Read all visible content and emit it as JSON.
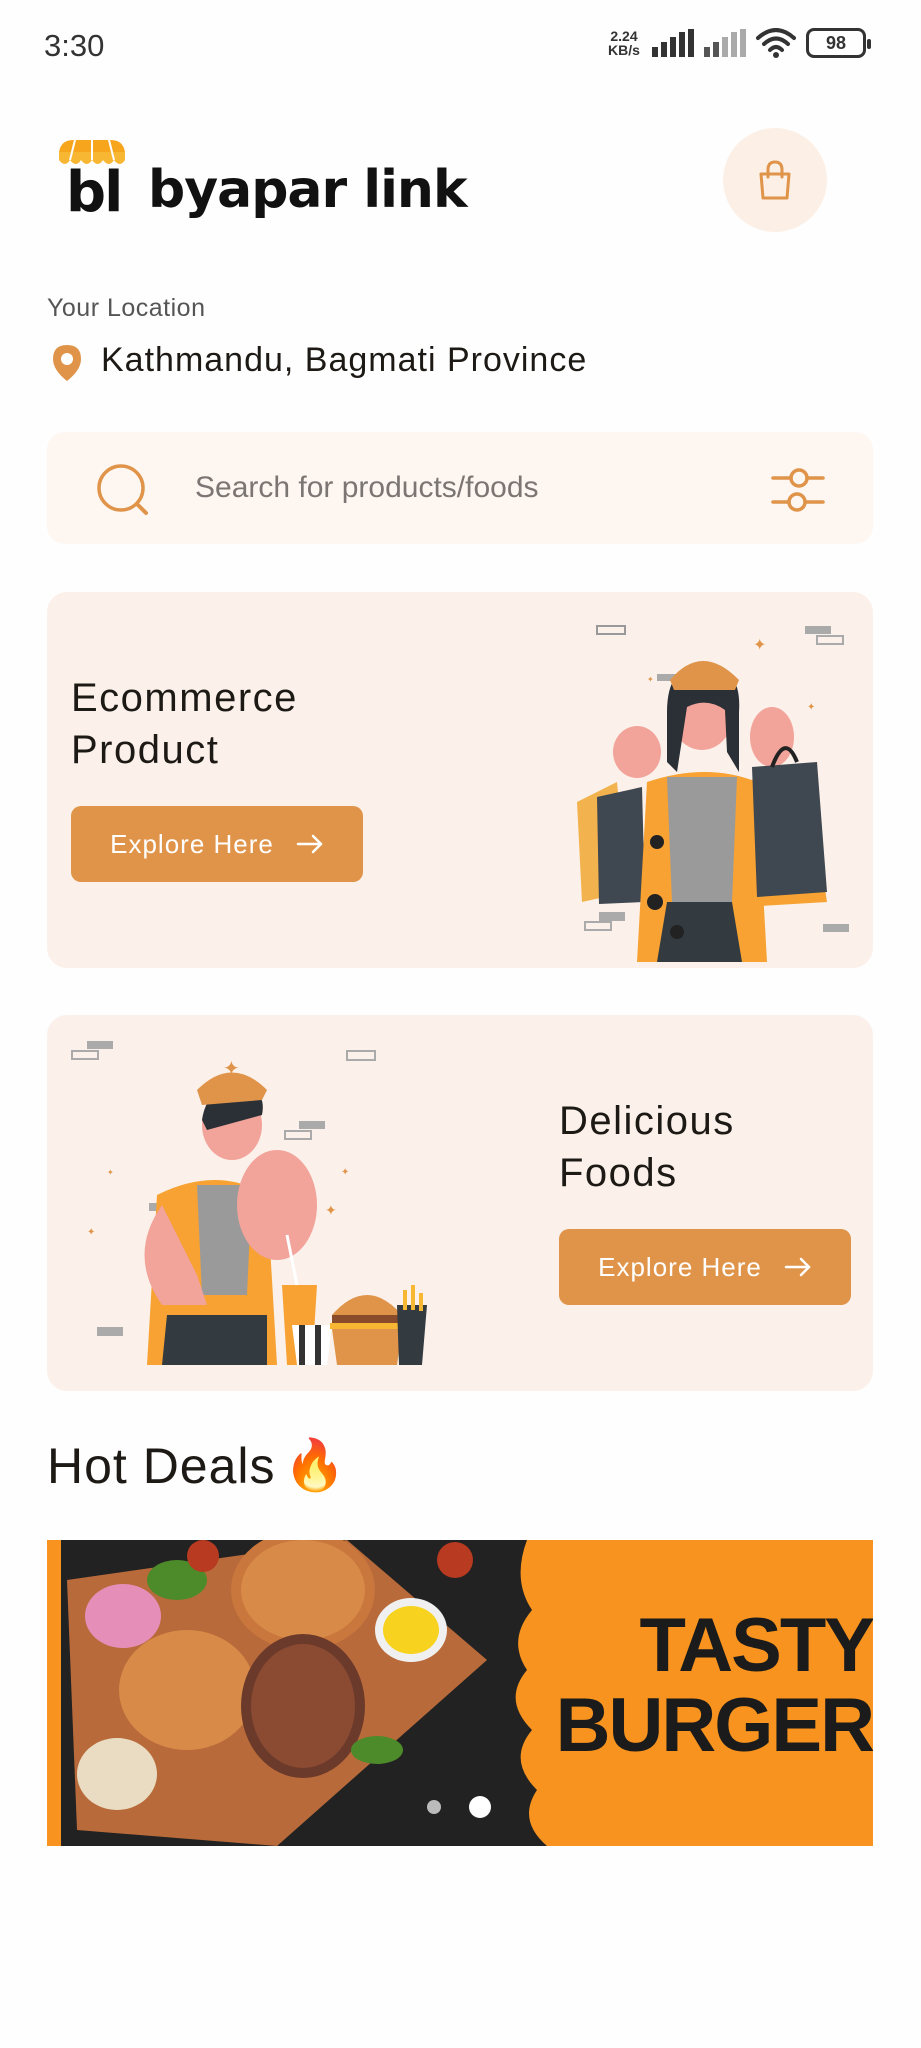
{
  "status": {
    "time": "3:30",
    "net_speed_value": "2.24",
    "net_speed_unit": "KB/s",
    "battery": "98"
  },
  "header": {
    "logo_mark": "bl",
    "logo_text": "byapar link",
    "cart_icon": "shopping-bag-icon"
  },
  "location": {
    "label": "Your Location",
    "value": "Kathmandu, Bagmati Province"
  },
  "search": {
    "placeholder": "Search for products/foods"
  },
  "cards": [
    {
      "title_line1": "Ecommerce",
      "title_line2": "Product",
      "button": "Explore Here"
    },
    {
      "title_line1": "Delicious",
      "title_line2": "Foods",
      "button": "Explore Here"
    }
  ],
  "hot_deals": {
    "title": "Hot Deals",
    "emoji": "🔥",
    "banner_line1": "TASTY",
    "banner_line2": "BURGER",
    "slide_count": 2,
    "active_slide": 2
  },
  "colors": {
    "accent": "#e0944a",
    "card_bg": "#fbf1ea",
    "search_bg": "#fdf6f1",
    "banner_orange": "#f7931e"
  }
}
